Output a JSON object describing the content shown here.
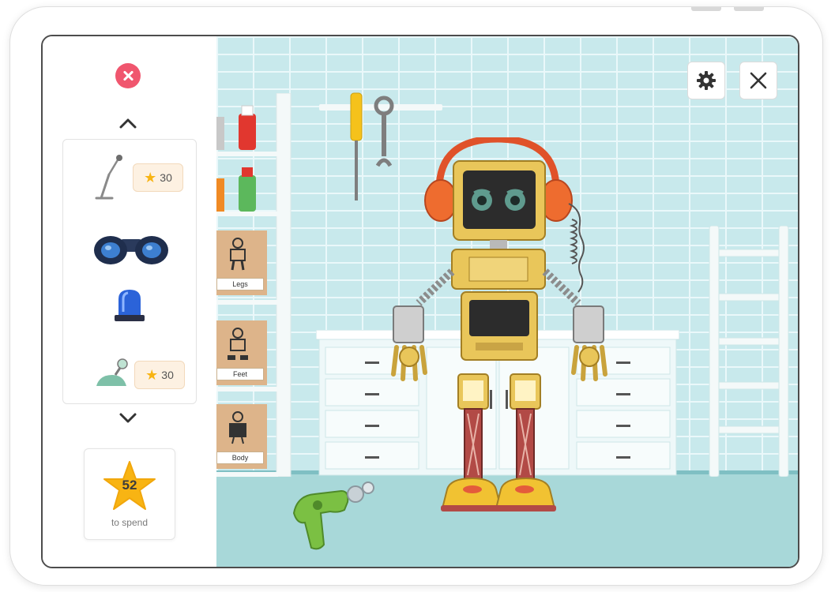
{
  "sidebar": {
    "items": [
      {
        "name": "microphone",
        "price": "30",
        "locked": true
      },
      {
        "name": "binoculars",
        "locked": false
      },
      {
        "name": "siren-light",
        "locked": false
      },
      {
        "name": "joystick",
        "price": "30",
        "locked": true
      }
    ],
    "balance": {
      "value": "52",
      "label": "to spend"
    }
  },
  "shelf": {
    "cards": [
      {
        "label": "Legs"
      },
      {
        "label": "Feet"
      },
      {
        "label": "Body"
      }
    ]
  },
  "colors": {
    "accent_red": "#f0566e",
    "star_yellow": "#f8b413",
    "wall": "#c8e9ec",
    "floor": "#a8d8d9",
    "robot_yellow": "#e9c65a",
    "headphone_orange": "#ee6c2f"
  }
}
